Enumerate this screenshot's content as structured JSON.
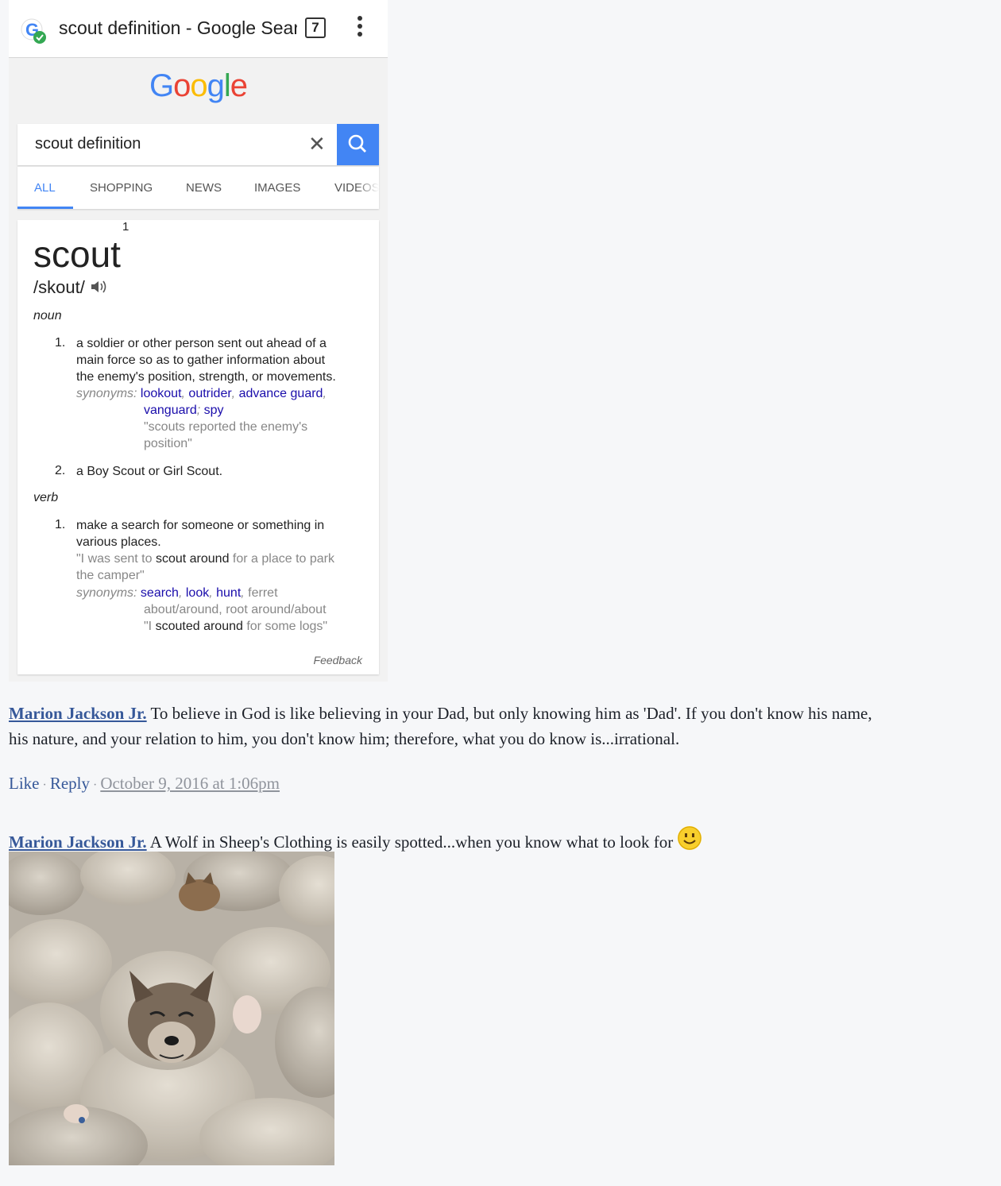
{
  "browser": {
    "tab_title": "scout definition - Google Searc",
    "tab_count": "7"
  },
  "google": {
    "logo_letters": [
      {
        "char": "G",
        "color": "#4285f4"
      },
      {
        "char": "o",
        "color": "#ea4335"
      },
      {
        "char": "o",
        "color": "#fbbc05"
      },
      {
        "char": "g",
        "color": "#4285f4"
      },
      {
        "char": "l",
        "color": "#34a853"
      },
      {
        "char": "e",
        "color": "#ea4335"
      }
    ],
    "query": "scout definition",
    "tabs": [
      "ALL",
      "SHOPPING",
      "NEWS",
      "IMAGES",
      "VIDEOS"
    ]
  },
  "definition": {
    "word": "scout",
    "superscript": "1",
    "phonetic": "/skout/",
    "noun_label": "noun",
    "noun_1_num": "1.",
    "noun_1_lines": [
      "a soldier or other person sent out ahead of a",
      "main force so as to gather information about",
      "the enemy's position, strength, or movements."
    ],
    "synonyms_label": "synonyms:",
    "noun_1_syn_line1": [
      "lookout",
      "outrider",
      "advance guard"
    ],
    "noun_1_syn_line2": [
      "vanguard",
      "spy"
    ],
    "noun_1_example": [
      "\"scouts reported the enemy's",
      "position\""
    ],
    "noun_2_num": "2.",
    "noun_2_text": "a Boy Scout or Girl Scout.",
    "verb_label": "verb",
    "verb_1_num": "1.",
    "verb_1_lines": [
      "make a search for someone or something in",
      "various places."
    ],
    "verb_1_example_pre": "\"I was sent to ",
    "verb_1_example_bold": "scout around",
    "verb_1_example_post": " for a place to park",
    "verb_1_example_line2": "the camper\"",
    "verb_1_syn": [
      "search",
      "look",
      "hunt"
    ],
    "verb_1_syn_plain1": "ferret",
    "verb_1_syn_plain2": "about/around, root around/about",
    "verb_1_example2_pre": "\"I ",
    "verb_1_example2_bold": "scouted around",
    "verb_1_example2_post": " for some logs\"",
    "feedback": "Feedback"
  },
  "comments": [
    {
      "author": "Marion Jackson Jr.",
      "text_line1": "To believe in God is like believing in your Dad, but only knowing him as 'Dad'. If you don't know his name,",
      "text_line2": "his nature, and your relation to him, you don't know him; therefore, what you do know is...irrational.",
      "like": "Like",
      "reply": "Reply",
      "timestamp": "October 9, 2016 at 1:06pm"
    },
    {
      "author": "Marion Jackson Jr.",
      "text": "A Wolf in Sheep's Clothing is easily spotted...when you know what to look for"
    }
  ],
  "colors": {
    "google_blue": "#4285f4",
    "link_blue": "#365899",
    "synonym_blue": "#1a0dab",
    "fb_background": "#f6f7f9"
  }
}
